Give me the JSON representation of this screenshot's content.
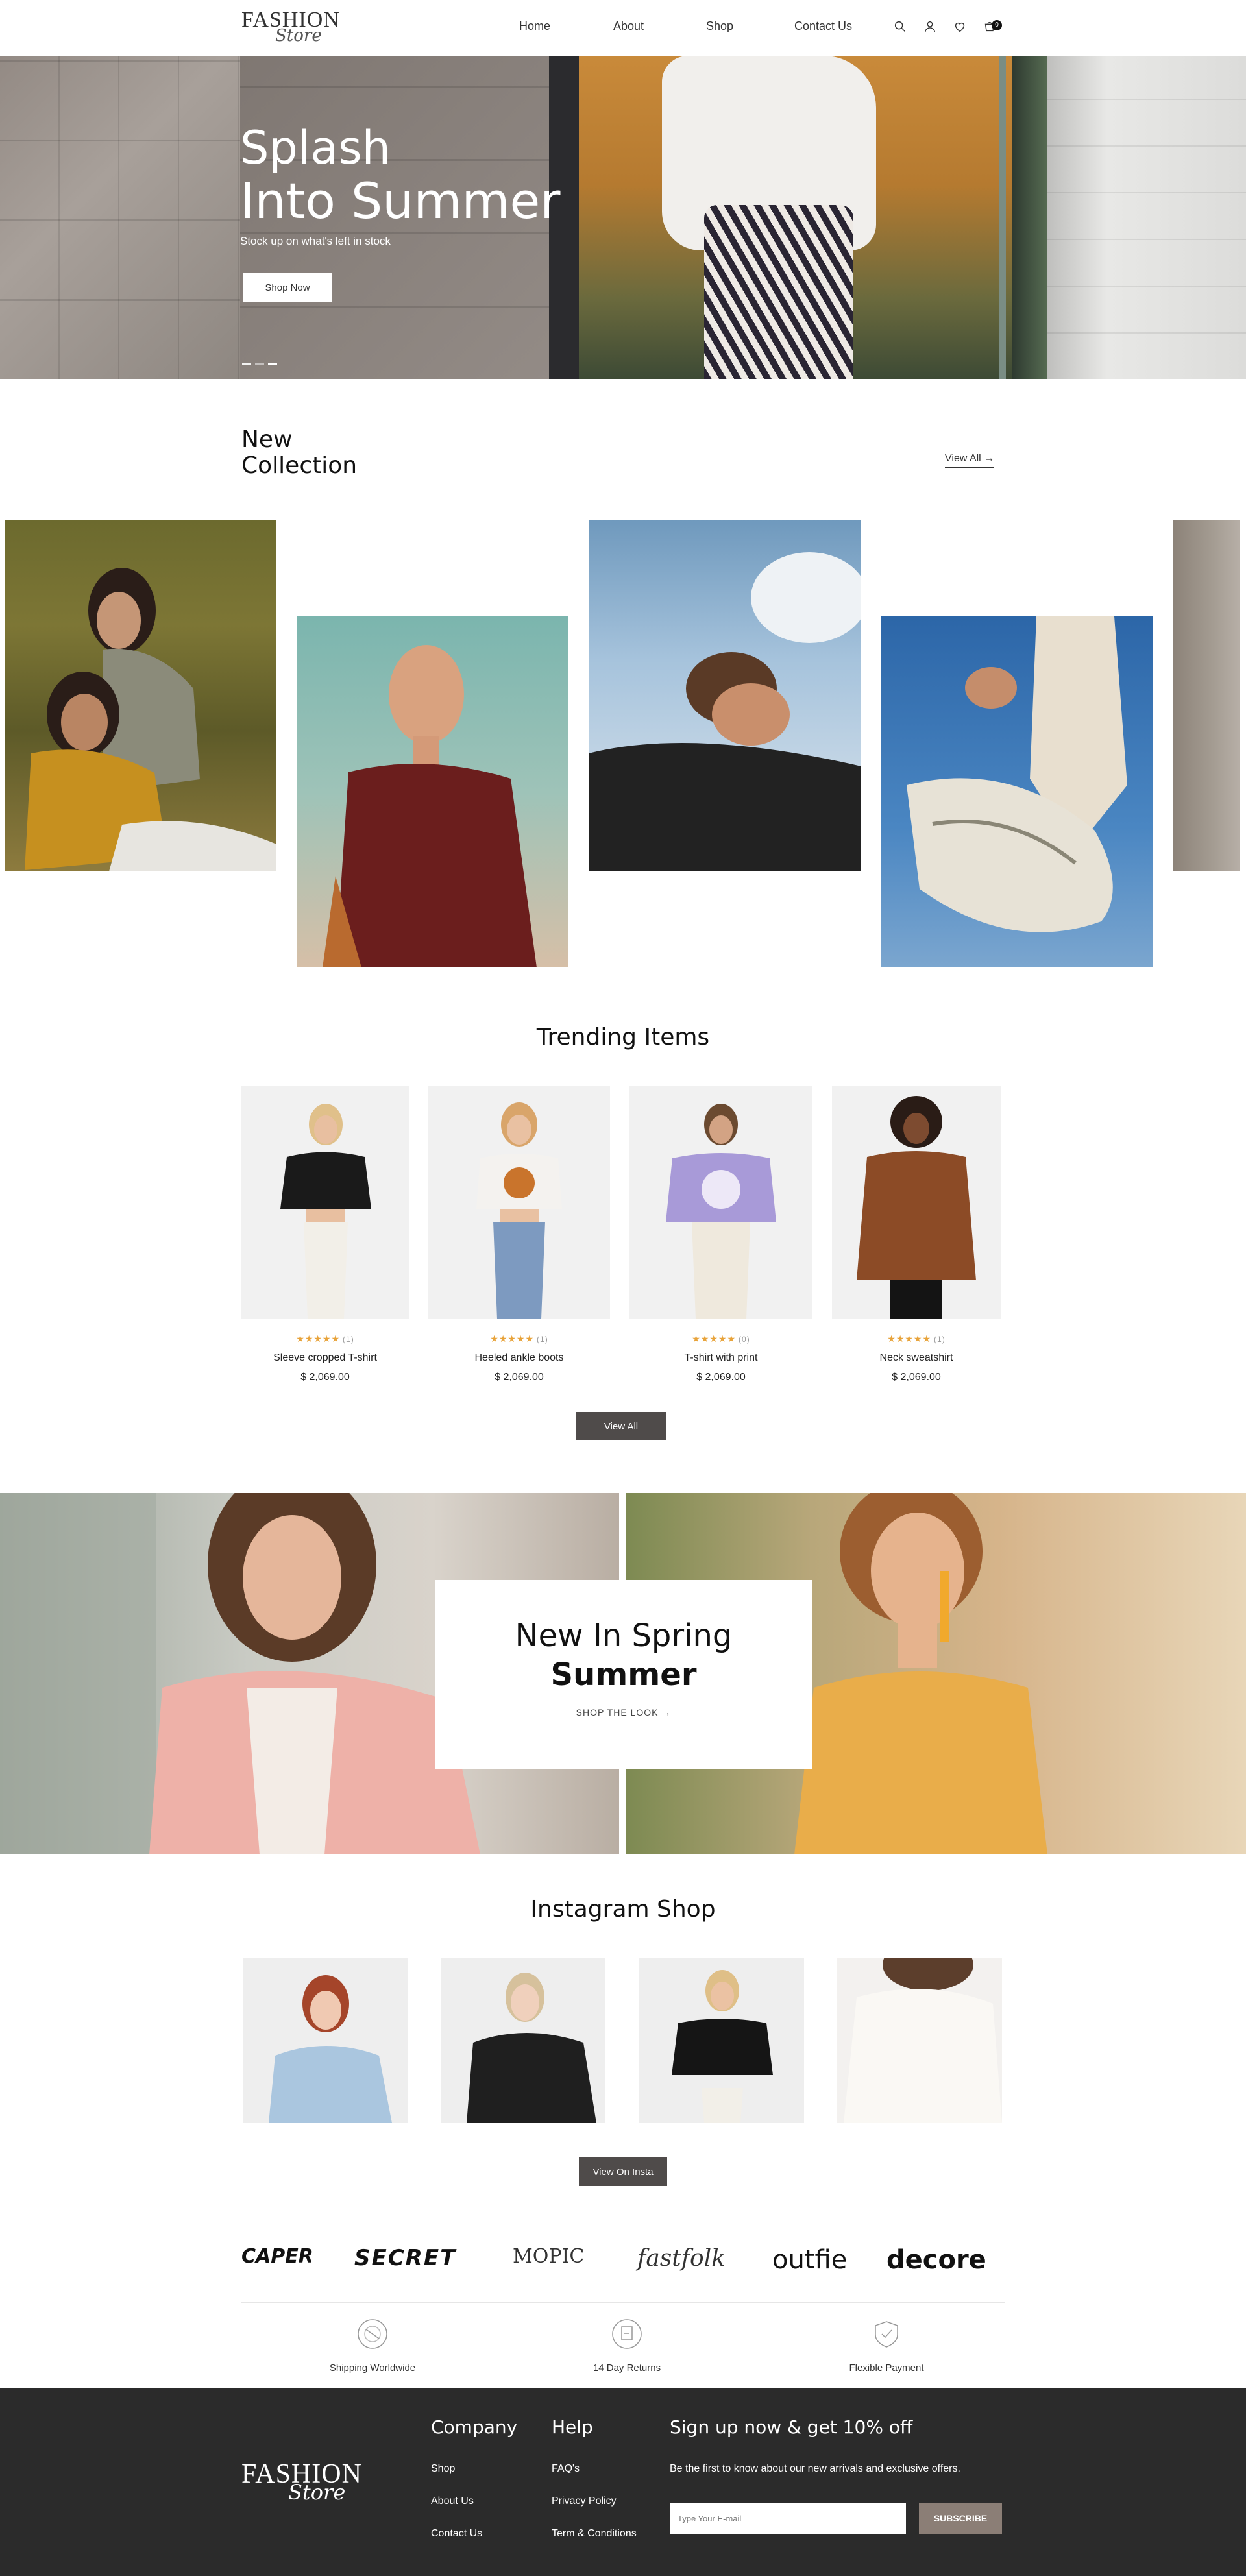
{
  "header": {
    "logo_line1": "FASHION",
    "logo_line2": "Store",
    "nav": [
      "Home",
      "About",
      "Shop",
      "Contact Us"
    ],
    "cart_count": "0",
    "icons": [
      "search-icon",
      "user-icon",
      "heart-icon",
      "cart-icon"
    ]
  },
  "hero": {
    "title_line1": "Splash",
    "title_line2": "Into Summer",
    "subtitle": "Stock up on what's left in stock",
    "button": "Shop Now",
    "slide_count": 3,
    "active_slide": 3
  },
  "collection": {
    "title_line1": "New",
    "title_line2": "Collection",
    "view_all": "View All",
    "arrow": "→"
  },
  "trending": {
    "title": "Trending Items",
    "button": "View All",
    "products": [
      {
        "name": "Sleeve cropped T-shirt",
        "price": "$ 2,069.00",
        "stars": "★★★★★",
        "count": "(1)",
        "rating": 4
      },
      {
        "name": "Heeled ankle boots",
        "price": "$ 2,069.00",
        "stars": "★★★★★",
        "count": "(1)",
        "rating": 5
      },
      {
        "name": "T-shirt with print",
        "price": "$ 2,069.00",
        "stars": "★★★★★",
        "count": "(0)",
        "rating": 4
      },
      {
        "name": "Neck sweatshirt",
        "price": "$ 2,069.00",
        "stars": "★★★★★",
        "count": "(1)",
        "rating": 4
      }
    ]
  },
  "banner": {
    "line1": "New In Spring",
    "line2": "Summer",
    "link": "SHOP THE LOOK →"
  },
  "instagram": {
    "title": "Instagram Shop",
    "button": "View On Insta"
  },
  "brands": [
    "CAPER",
    "SECRET",
    "MOPIC",
    "fastfolk",
    "outfie",
    "decore"
  ],
  "features": [
    {
      "label": "Shipping Worldwide",
      "icon": "shipping-icon"
    },
    {
      "label": "14 Day Returns",
      "icon": "returns-icon"
    },
    {
      "label": "Flexible Payment",
      "icon": "payment-shield-icon"
    }
  ],
  "footer": {
    "logo_line1": "FASHION",
    "logo_line2": "Store",
    "company_title": "Company",
    "company_links": [
      "Shop",
      "About Us",
      "Contact Us"
    ],
    "help_title": "Help",
    "help_links": [
      "FAQ's",
      "Privacy Policy",
      "Term & Conditions"
    ],
    "signup_title": "Sign up now & get 10% off",
    "signup_text": "Be the first to know about our new arrivals and exclusive offers.",
    "email_placeholder": "Type Your E-mail",
    "subscribe": "SUBSCRIBE"
  },
  "colors": {
    "accent_dark": "#4f4b4a",
    "footer_bg": "#2b2b2b",
    "subscribe_bg": "#8b7e76",
    "star": "#e8a33a"
  }
}
